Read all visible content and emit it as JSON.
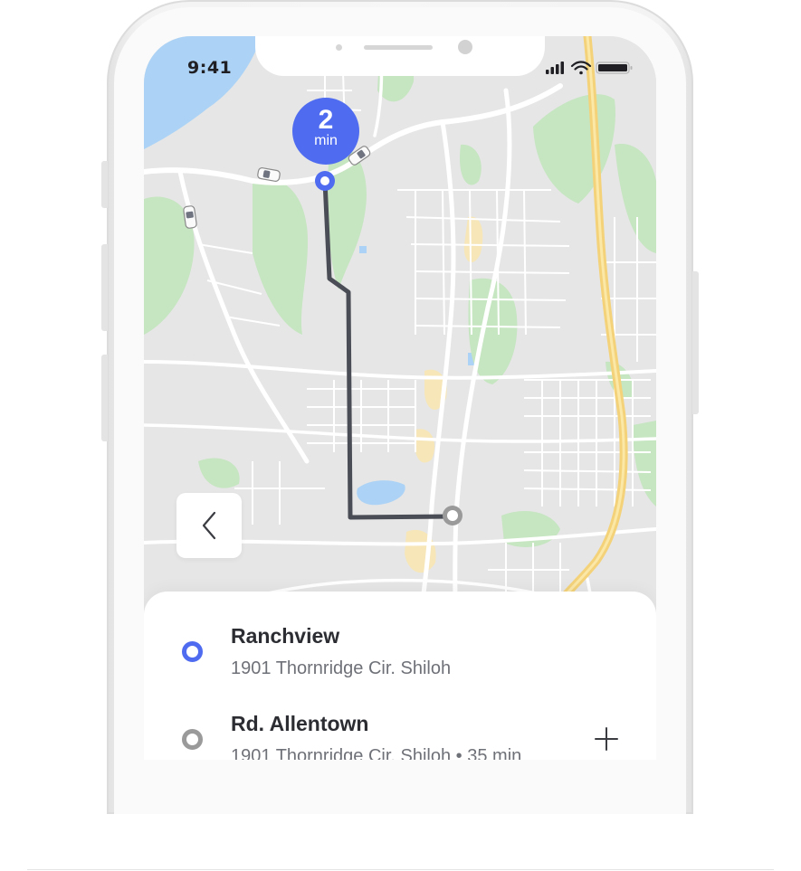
{
  "status_bar": {
    "time": "9:41"
  },
  "map": {
    "eta_badge": {
      "value": "2",
      "unit": "min"
    },
    "route_color": "#4a4d55",
    "origin_marker_color": "#4f6cf0",
    "destination_marker_color": "#9a9a9a"
  },
  "navigation": {
    "back_icon": "chevron-left-icon"
  },
  "trip": {
    "stops": [
      {
        "title": "Ranchview",
        "subtitle": "1901 Thornridge Cir. Shiloh",
        "marker": "origin"
      },
      {
        "title": "Rd. Allentown",
        "subtitle": "1901 Thornridge Cir. Shiloh • 35 min",
        "marker": "destination"
      }
    ],
    "add_stop_icon": "plus-icon"
  }
}
